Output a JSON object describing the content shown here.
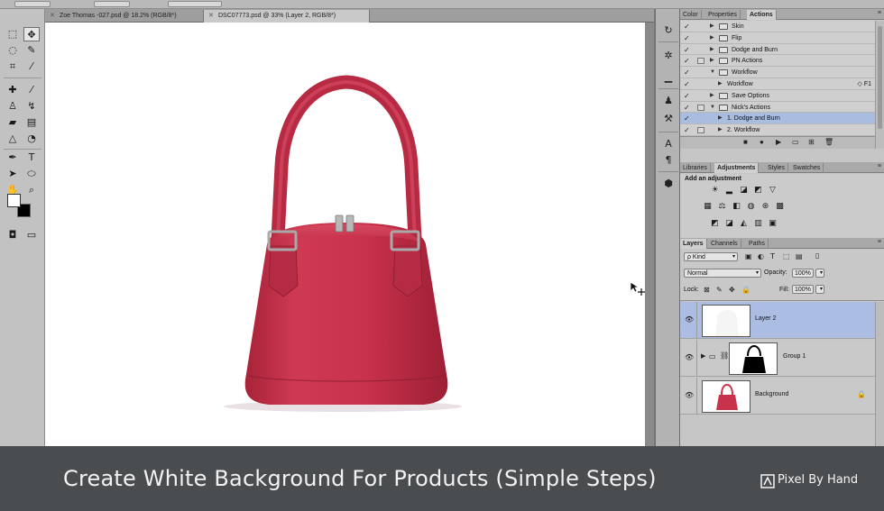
{
  "tabs": [
    {
      "label": "Zoe Thomas -027.psd @ 18.2% (RGB/8*)",
      "active": false
    },
    {
      "label": "DSC07773.psd @ 33% (Layer 2, RGB/8*)",
      "active": true
    }
  ],
  "actions_panel": {
    "tabs": [
      "Color",
      "Properties",
      "Actions"
    ],
    "active_tab": "Actions",
    "items": [
      {
        "label": "Skin",
        "level": 0,
        "type": "set",
        "expanded": false,
        "dialog": false,
        "selected": false,
        "key": ""
      },
      {
        "label": "Flip",
        "level": 0,
        "type": "set",
        "expanded": false,
        "dialog": false,
        "selected": false,
        "key": ""
      },
      {
        "label": "Dodge and Burn",
        "level": 0,
        "type": "set",
        "expanded": false,
        "dialog": false,
        "selected": false,
        "key": ""
      },
      {
        "label": "PN Actions",
        "level": 0,
        "type": "set",
        "expanded": false,
        "dialog": true,
        "selected": false,
        "key": ""
      },
      {
        "label": "Workflow",
        "level": 0,
        "type": "set",
        "expanded": true,
        "dialog": false,
        "selected": false,
        "key": ""
      },
      {
        "label": "Workflow",
        "level": 1,
        "type": "action",
        "expanded": false,
        "dialog": false,
        "selected": false,
        "key": "◇ F1"
      },
      {
        "label": "Save Options",
        "level": 0,
        "type": "set",
        "expanded": false,
        "dialog": false,
        "selected": false,
        "key": ""
      },
      {
        "label": "Nick's Actions",
        "level": 0,
        "type": "set",
        "expanded": true,
        "dialog": true,
        "selected": false,
        "key": ""
      },
      {
        "label": "1. Dodge and Burn",
        "level": 1,
        "type": "action",
        "expanded": false,
        "dialog": false,
        "selected": true,
        "key": ""
      },
      {
        "label": "2. Workflow",
        "level": 1,
        "type": "action",
        "expanded": false,
        "dialog": true,
        "selected": false,
        "key": ""
      }
    ]
  },
  "adjustments_panel": {
    "tabs": [
      "Libraries",
      "Adjustments",
      "Styles",
      "Swatches"
    ],
    "active_tab": "Adjustments",
    "title": "Add an adjustment"
  },
  "layers_panel": {
    "tabs": [
      "Layers",
      "Channels",
      "Paths"
    ],
    "active_tab": "Layers",
    "filter_kind": "ρ Kind",
    "blend_mode": "Normal",
    "opacity_label": "Opacity:",
    "opacity_value": "100%",
    "lock_label": "Lock:",
    "fill_label": "Fill:",
    "fill_value": "100%",
    "layers": [
      {
        "name": "Layer 2",
        "selected": true
      },
      {
        "name": "Group 1",
        "selected": false
      },
      {
        "name": "Background",
        "selected": false
      }
    ]
  },
  "caption": {
    "title": "Create White Background For Products (Simple Steps)",
    "brand": "Pixel By Hand"
  },
  "colors": {
    "product_red": "#c8324a",
    "selection_blue": "#abbde3",
    "banner": "#4a4d4f"
  }
}
